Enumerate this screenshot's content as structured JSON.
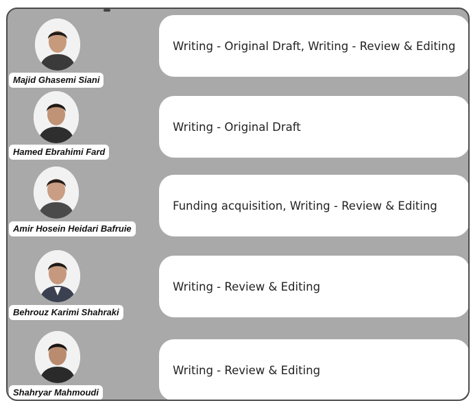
{
  "contributors": [
    {
      "name": "Majid Ghasemi Siani",
      "role": "Writing - Original Draft, Writing - Review & Editing"
    },
    {
      "name": "Hamed Ebrahimi Fard",
      "role": "Writing - Original Draft"
    },
    {
      "name": "Amir Hosein Heidari Bafruie",
      "role": "Funding acquisition, Writing - Review & Editing"
    },
    {
      "name": "Behrouz Karimi Shahraki",
      "role": "Writing - Review & Editing"
    },
    {
      "name": "Shahryar Mahmoudi",
      "role": "Writing - Review & Editing"
    }
  ],
  "colors": {
    "panel": "#a9a9a9",
    "border": "#4a4a4a",
    "card": "#ffffff"
  }
}
